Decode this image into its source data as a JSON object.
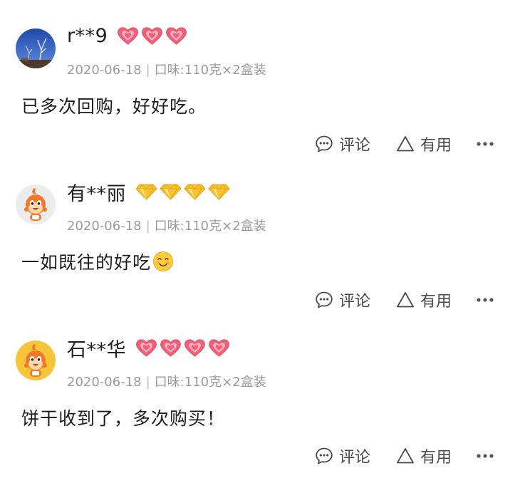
{
  "reviews": [
    {
      "username": "r**9",
      "level_icon": "red-heart-icon",
      "level_count": 3,
      "date": "2020-06-18",
      "separator": "|",
      "spec": "口味:110克×2盒装",
      "content": "已多次回购，好好吃。",
      "comment_label": "评论",
      "useful_label": "有用"
    },
    {
      "username": "有**丽",
      "level_icon": "gold-diamond-icon",
      "level_count": 4,
      "date": "2020-06-18",
      "separator": "|",
      "spec": "口味:110克×2盒装",
      "content": "一如既往的好吃",
      "emoji": "smiling-face-emoji",
      "comment_label": "评论",
      "useful_label": "有用"
    },
    {
      "username": "石**华",
      "level_icon": "red-heart-icon",
      "level_count": 4,
      "date": "2020-06-18",
      "separator": "|",
      "spec": "口味:110克×2盒装",
      "content": "饼干收到了，多次购买！",
      "comment_label": "评论",
      "useful_label": "有用"
    }
  ],
  "colors": {
    "heart": "#f0607a",
    "diamond": "#f7c331",
    "meta_text": "#9a9a9a",
    "mascot_orange": "#f4782a",
    "mascot_background_yellow": "#f7c43a"
  }
}
